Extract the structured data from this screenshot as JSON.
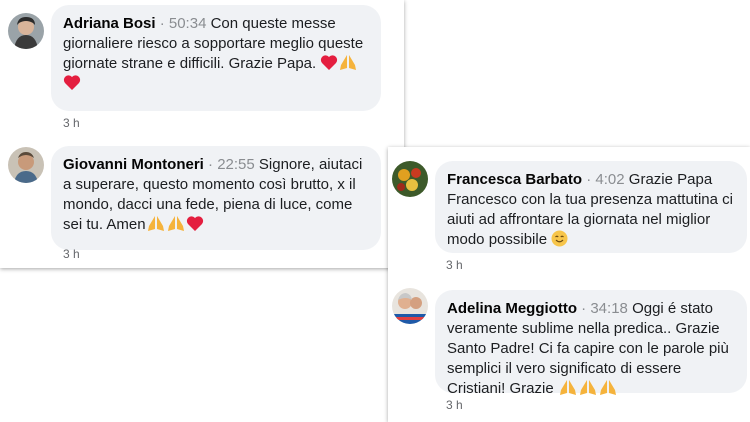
{
  "comments": [
    {
      "author": "Adriana Bosi",
      "timestamp": "50:34",
      "text": "Con queste messe giornaliere riesco a sopportare meglio queste giornate strane e difficili. Grazie Papa.",
      "emoji": [
        "heart",
        "pray",
        "heart"
      ],
      "age": "3 h"
    },
    {
      "author": "Giovanni Montoneri",
      "timestamp": "22:55",
      "text": "Signore, aiutaci a superare, questo momento così brutto, x il mondo, dacci una fede, piena di luce, come sei tu. Amen",
      "emoji": [
        "pray",
        "pray",
        "heart"
      ],
      "age": "3 h"
    },
    {
      "author": "Francesca Barbato",
      "timestamp": "4:02",
      "text": "Grazie Papa Francesco con la tua presenza mattutina ci aiuti ad affrontare la giornata nel miglior modo possibile",
      "emoji": [
        "smile"
      ],
      "age": "3 h"
    },
    {
      "author": "Adelina Meggiotto",
      "timestamp": "34:18",
      "text": "Oggi é stato veramente sublime nella predica.. Grazie Santo Padre! Ci fa capire con le parole più semplici il vero significato di essere Cristiani! Grazie",
      "emoji": [
        "pray",
        "pray",
        "pray"
      ],
      "age": "3 h"
    }
  ],
  "separator": "·",
  "colors": {
    "bubble": "#f0f2f5",
    "author": "#050505",
    "timestamp": "#8a8d91",
    "meta": "#65676b",
    "heart": "#e41e3f",
    "pray": "#f5b33c"
  }
}
